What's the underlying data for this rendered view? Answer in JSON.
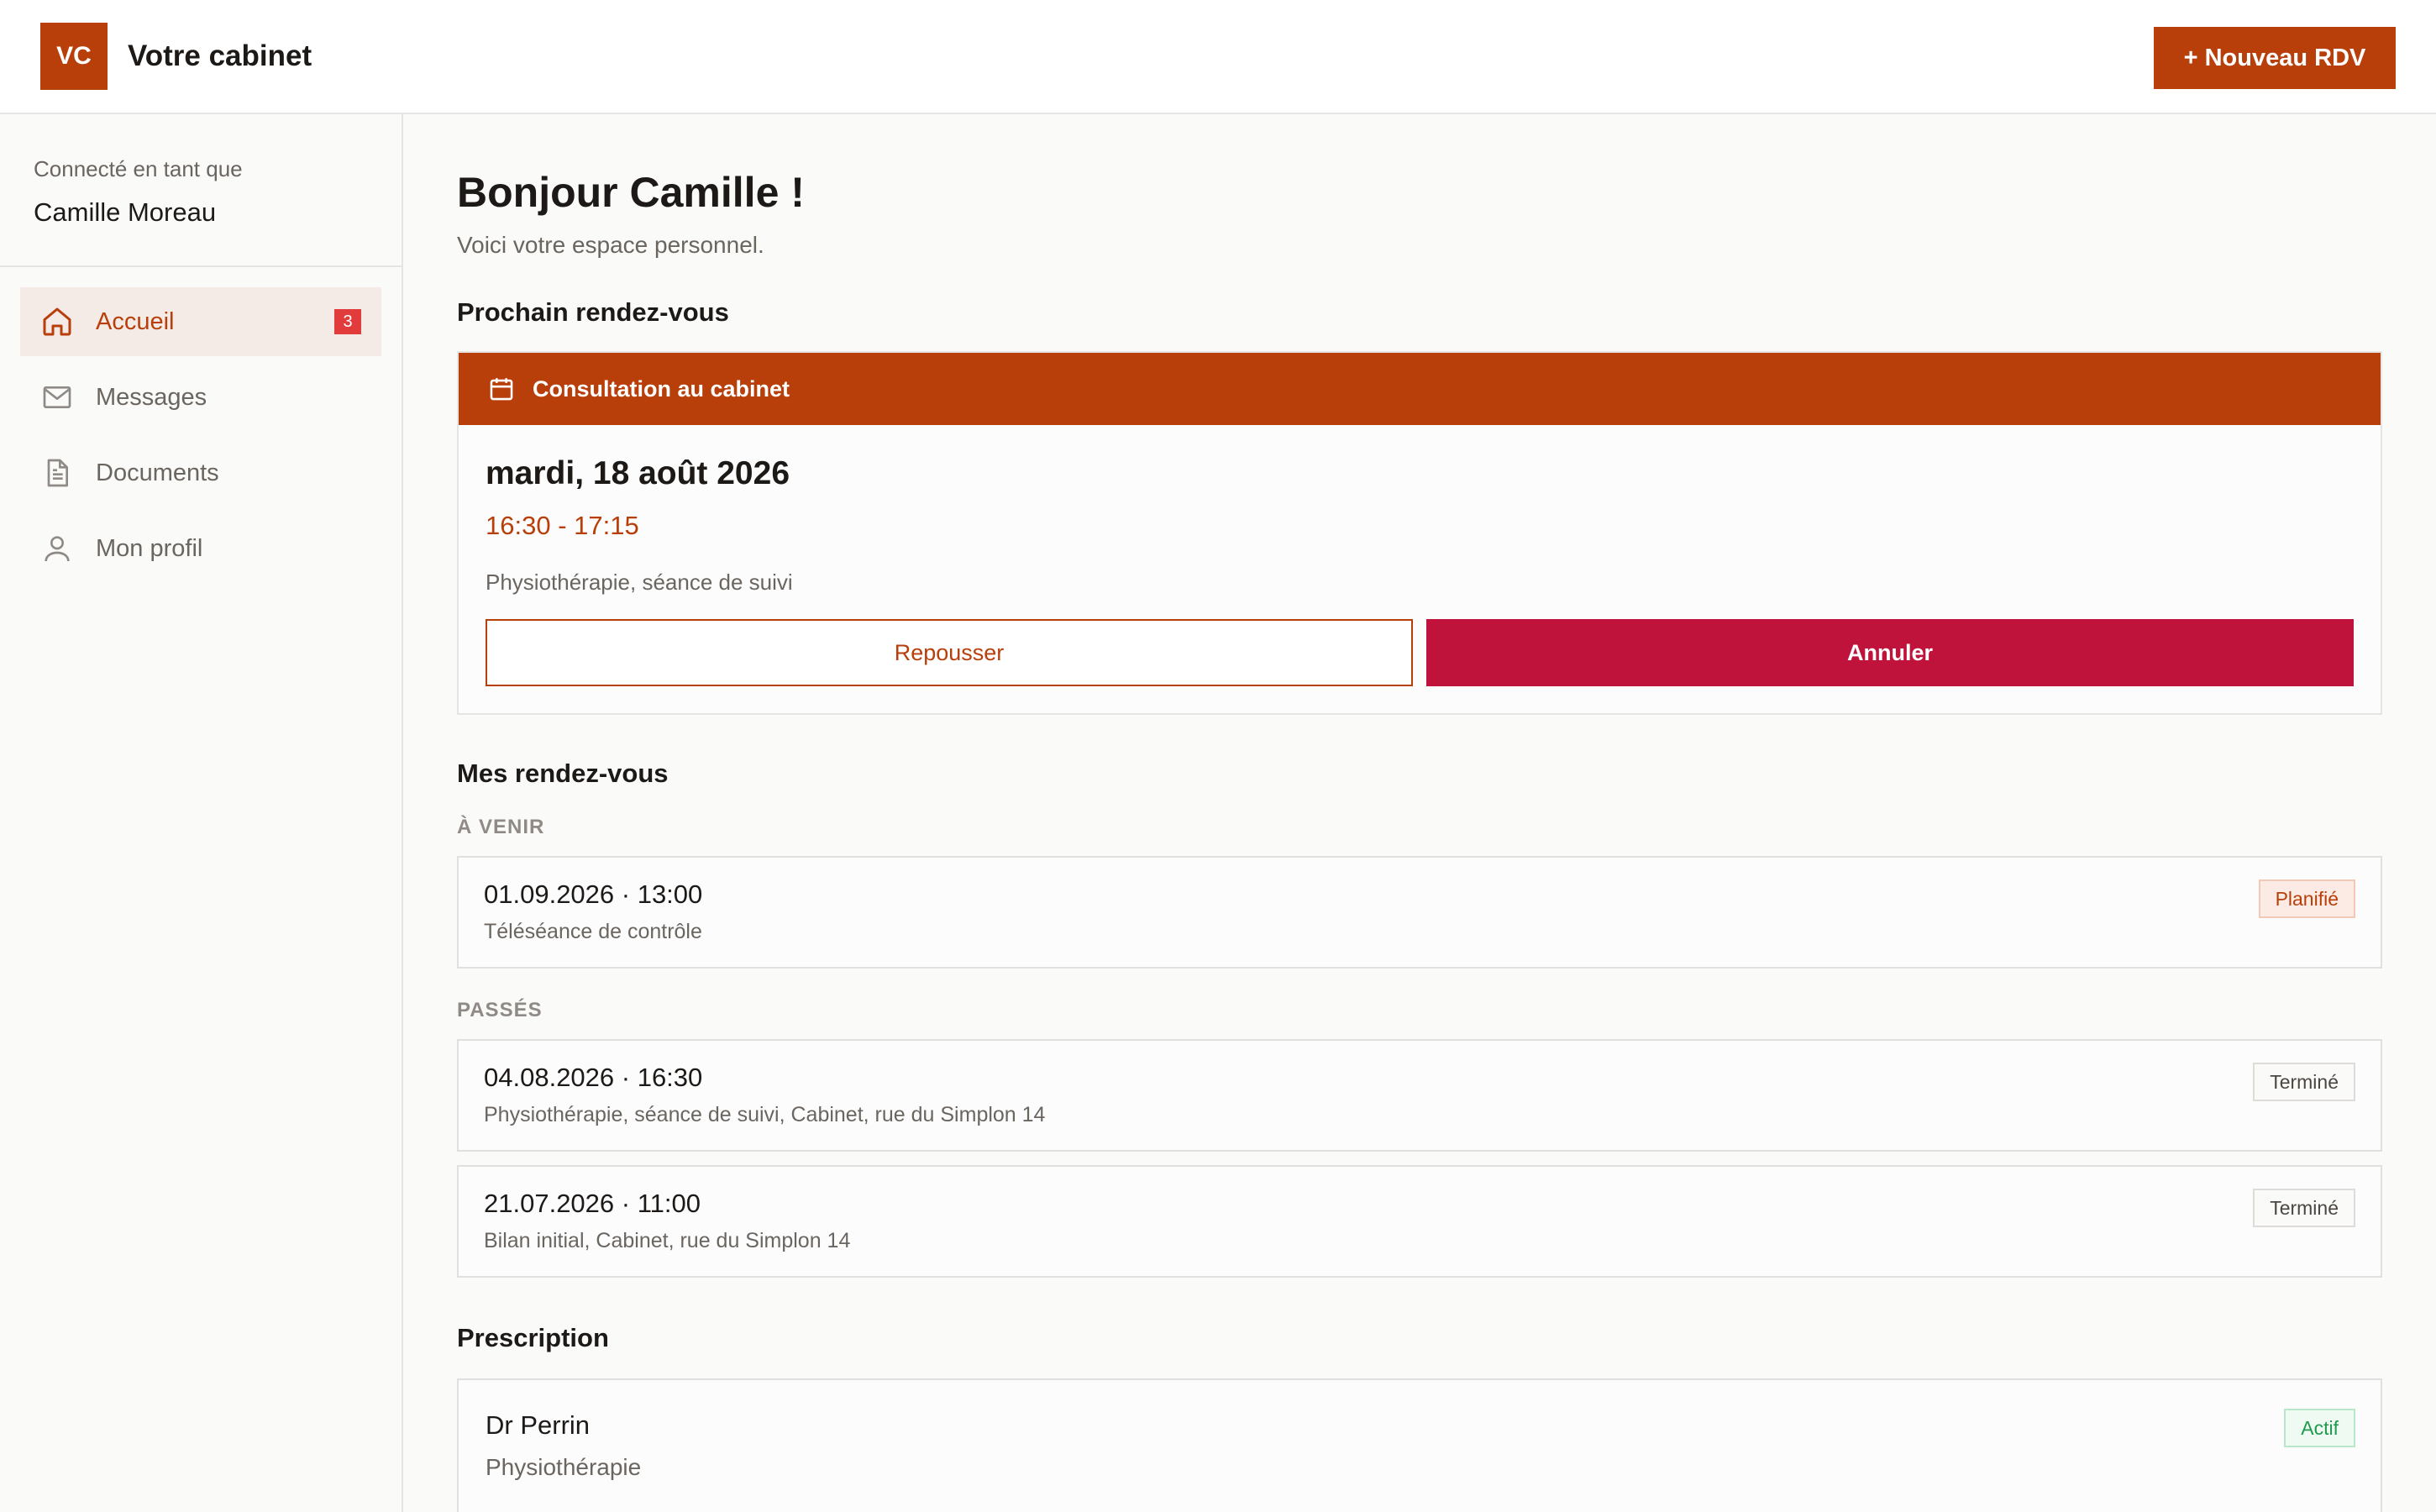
{
  "header": {
    "logo_text": "VC",
    "brand": "Votre cabinet",
    "new_appointment_label": "+ Nouveau RDV"
  },
  "sidebar": {
    "user_caption": "Connecté en tant que",
    "user_name": "Camille Moreau",
    "items": [
      {
        "label": "Accueil",
        "icon": "home-icon",
        "active": true,
        "badge": "3"
      },
      {
        "label": "Messages",
        "icon": "mail-icon"
      },
      {
        "label": "Documents",
        "icon": "document-icon"
      },
      {
        "label": "Mon profil",
        "icon": "user-icon"
      }
    ]
  },
  "main": {
    "greeting": "Bonjour Camille !",
    "subtitle": "Voici votre espace personnel.",
    "next": {
      "section_title": "Prochain rendez-vous",
      "type": "Consultation au cabinet",
      "type_icon": "calendar-icon",
      "date": "mardi, 18 août 2026",
      "time": "16:30 - 17:15",
      "description": "Physiothérapie, séance de suivi",
      "postpone_label": "Repousser",
      "cancel_label": "Annuler"
    },
    "appointments": {
      "section_title": "Mes rendez-vous",
      "upcoming_label": "À VENIR",
      "upcoming": [
        {
          "datetime": "01.09.2026 · 13:00",
          "description": "Téléséance de contrôle",
          "status": "Planifié"
        }
      ],
      "past_label": "PASSÉS",
      "past": [
        {
          "datetime": "04.08.2026 · 16:30",
          "description": "Physiothérapie, séance de suivi, Cabinet, rue du Simplon 14",
          "status": "Terminé"
        },
        {
          "datetime": "21.07.2026 · 11:00",
          "description": "Bilan initial, Cabinet, rue du Simplon 14",
          "status": "Terminé"
        }
      ]
    },
    "prescription": {
      "section_title": "Prescription",
      "doctor": "Dr Perrin",
      "field": "Physiothérapie",
      "status": "Actif"
    }
  },
  "colors": {
    "brand": "#b83f0a",
    "danger": "#c0133c",
    "badge_red": "#e23b3b",
    "success": "#1f9a4e"
  }
}
